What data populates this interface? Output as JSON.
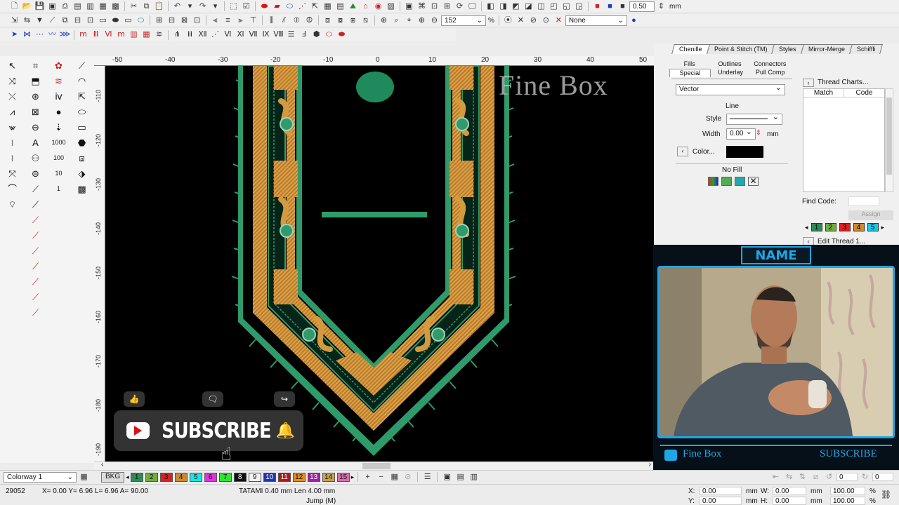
{
  "toolbar": {
    "zoom_value": "152",
    "zoom_unit": "%",
    "none_label": "None",
    "thickness_value": "0.50",
    "thickness_unit": "mm"
  },
  "ruler": {
    "top_ticks": [
      "-50",
      "-40",
      "-30",
      "-20",
      "-10",
      "0",
      "10",
      "20",
      "30",
      "40",
      "50"
    ],
    "left_ticks": [
      "-110",
      "-120",
      "-130",
      "-140",
      "-150",
      "-160",
      "-170",
      "-180",
      "-190"
    ]
  },
  "canvas": {
    "watermark": "Fine Box"
  },
  "overlay": {
    "subscribe": "SUBSCRIBE"
  },
  "panel": {
    "main_tabs": [
      "Chenille",
      "Point & Stitch (TM)",
      "Styles",
      "Mirror-Merge",
      "Schiffli"
    ],
    "sub_tabs_row1": [
      "Fills",
      "Outlines",
      "Connectors"
    ],
    "sub_tabs_row2": [
      "Special",
      "Underlay",
      "Pull Comp"
    ],
    "object_type": "Vector",
    "line_label": "Line",
    "style_label": "Style",
    "width_label": "Width",
    "width_value": "0.00",
    "width_unit": "mm",
    "color_label": "Color...",
    "no_fill_label": "No Fill"
  },
  "threads": {
    "title": "Thread Charts...",
    "col_match": "Match",
    "col_code": "Code",
    "find_code_label": "Find Code:",
    "assign_label": "Assign",
    "edit_thread": "Edit Thread 1...",
    "chips": [
      {
        "n": "1",
        "color": "#2e8b57"
      },
      {
        "n": "2",
        "color": "#6fae3c"
      },
      {
        "n": "3",
        "color": "#e11d1d"
      },
      {
        "n": "4",
        "color": "#c98a32"
      },
      {
        "n": "5",
        "color": "#18c7e6"
      }
    ]
  },
  "webcam": {
    "name_badge": "NAME",
    "brand": "Fine Box",
    "subscribe": "SUBSCRIBE"
  },
  "colorway": {
    "label": "Colorway 1",
    "bkg": "BKG",
    "chips": [
      {
        "n": "1",
        "color": "#2e8b57"
      },
      {
        "n": "2",
        "color": "#6fae3c"
      },
      {
        "n": "3",
        "color": "#e11d1d"
      },
      {
        "n": "4",
        "color": "#c98a32"
      },
      {
        "n": "5",
        "color": "#18e6e6"
      },
      {
        "n": "6",
        "color": "#e62ee6"
      },
      {
        "n": "7",
        "color": "#2ee62e"
      },
      {
        "n": "8",
        "color": "#111111"
      },
      {
        "n": "9",
        "color": "#f2f2f2"
      },
      {
        "n": "10",
        "color": "#2233aa"
      },
      {
        "n": "11",
        "color": "#b01818"
      },
      {
        "n": "12",
        "color": "#e58c1e"
      },
      {
        "n": "13",
        "color": "#a020a0"
      },
      {
        "n": "14",
        "color": "#c9a050"
      },
      {
        "n": "15",
        "color": "#e06ab0"
      }
    ]
  },
  "status": {
    "stitch_count": "29052",
    "coords": "X= 0.00 Y= 6.96 L= 6.96 A= 90.00",
    "stitch_info": "TATAMI 0.40 mm Len 4.00 mm",
    "jump_info": "Jump (M)",
    "x_label": "X:",
    "y_label": "Y:",
    "w_label": "W:",
    "h_label": "H:",
    "x_val": "0.00",
    "y_val": "0.00",
    "w_val": "0.00",
    "h_val": "0.00",
    "unit": "mm",
    "pct_w": "100.00",
    "pct_h": "100.00",
    "pct": "%",
    "rot_a": "0",
    "rot_b": "0"
  },
  "colors": {
    "embroidery_green": "#2f9a6a",
    "embroidery_gold": "#c98a32",
    "accent_blue": "#1ea7e6"
  }
}
